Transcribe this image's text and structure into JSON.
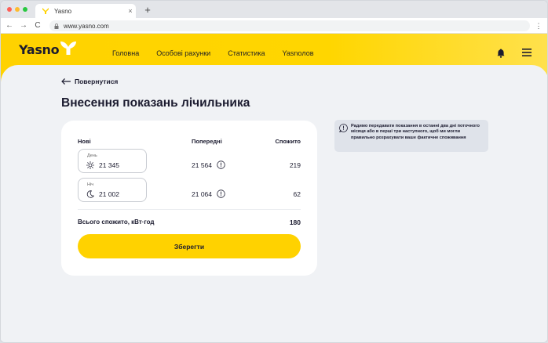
{
  "browser": {
    "tab_title": "Yasno",
    "tab_close": "×",
    "new_tab": "+",
    "url": "www.yasno.com",
    "back": "←",
    "forward": "→",
    "reload": "C",
    "menu": "⋮",
    "dot_colors": [
      "#ff5f57",
      "#febc2e",
      "#28c840"
    ]
  },
  "header": {
    "logo": "Yasno",
    "nav": [
      "Головна",
      "Особові рахунки",
      "Статистика",
      "Yasnoлов"
    ],
    "icons": [
      "bell-icon",
      "hamburger-menu-icon"
    ],
    "accent": "#ffd200"
  },
  "page": {
    "back_label": "Повернутися",
    "title": "Внесення показань лічильника"
  },
  "readings": {
    "col_new": "Нові",
    "col_prev": "Попередні",
    "col_used": "Спожито",
    "rows": [
      {
        "label": "День",
        "icon": "sun-icon",
        "value": "21 345",
        "previous": "21 564",
        "used": "219"
      },
      {
        "label": "Ніч",
        "icon": "moon-icon",
        "value": "21 002",
        "previous": "21 064",
        "used": "62"
      }
    ],
    "total_label": "Всього спожито, кВт·год",
    "total_value": "180",
    "save_label": "Зберегти"
  },
  "hint": {
    "icon": "info-icon",
    "text": "Радимо передавати показання в останні два дні поточного місяця або в перші три наступного, щоб ми могли правильно розрахувати ваше фактичне споживання"
  }
}
